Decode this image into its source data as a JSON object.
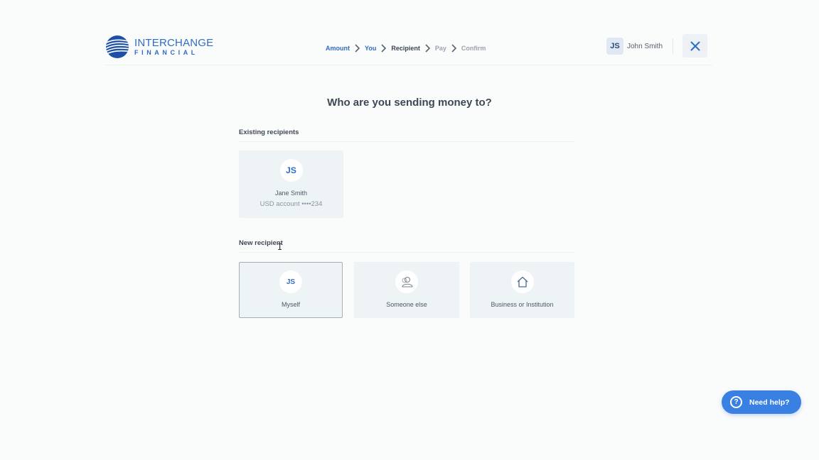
{
  "brand": {
    "name_line1": "INTERCHANGE",
    "name_line2": "FINANCIAL",
    "color": "#2f6cc4"
  },
  "steps": [
    {
      "label": "Amount",
      "state": "done"
    },
    {
      "label": "You",
      "state": "done"
    },
    {
      "label": "Recipient",
      "state": "current"
    },
    {
      "label": "Pay",
      "state": "upcoming"
    },
    {
      "label": "Confirm",
      "state": "upcoming"
    }
  ],
  "user": {
    "initials": "JS",
    "name": "John Smith"
  },
  "main": {
    "title": "Who are you sending money to?"
  },
  "existing": {
    "label": "Existing recipients",
    "items": [
      {
        "initials": "JS",
        "name": "Jane Smith",
        "account": "USD account ••••234"
      }
    ]
  },
  "new_recipient": {
    "label": "New recipient",
    "options": [
      {
        "initials": "JS",
        "label": "Myself",
        "icon": "",
        "selected": true
      },
      {
        "initials": "",
        "label": "Someone else",
        "icon": "person-icon",
        "selected": false
      },
      {
        "initials": "",
        "label": "Business or Institution",
        "icon": "house-icon",
        "selected": false
      }
    ]
  },
  "help": {
    "label": "Need help?",
    "icon": "question-icon"
  },
  "colors": {
    "accent": "#3a80e3",
    "text": "#3d4856",
    "card_bg": "#eef4f6"
  }
}
